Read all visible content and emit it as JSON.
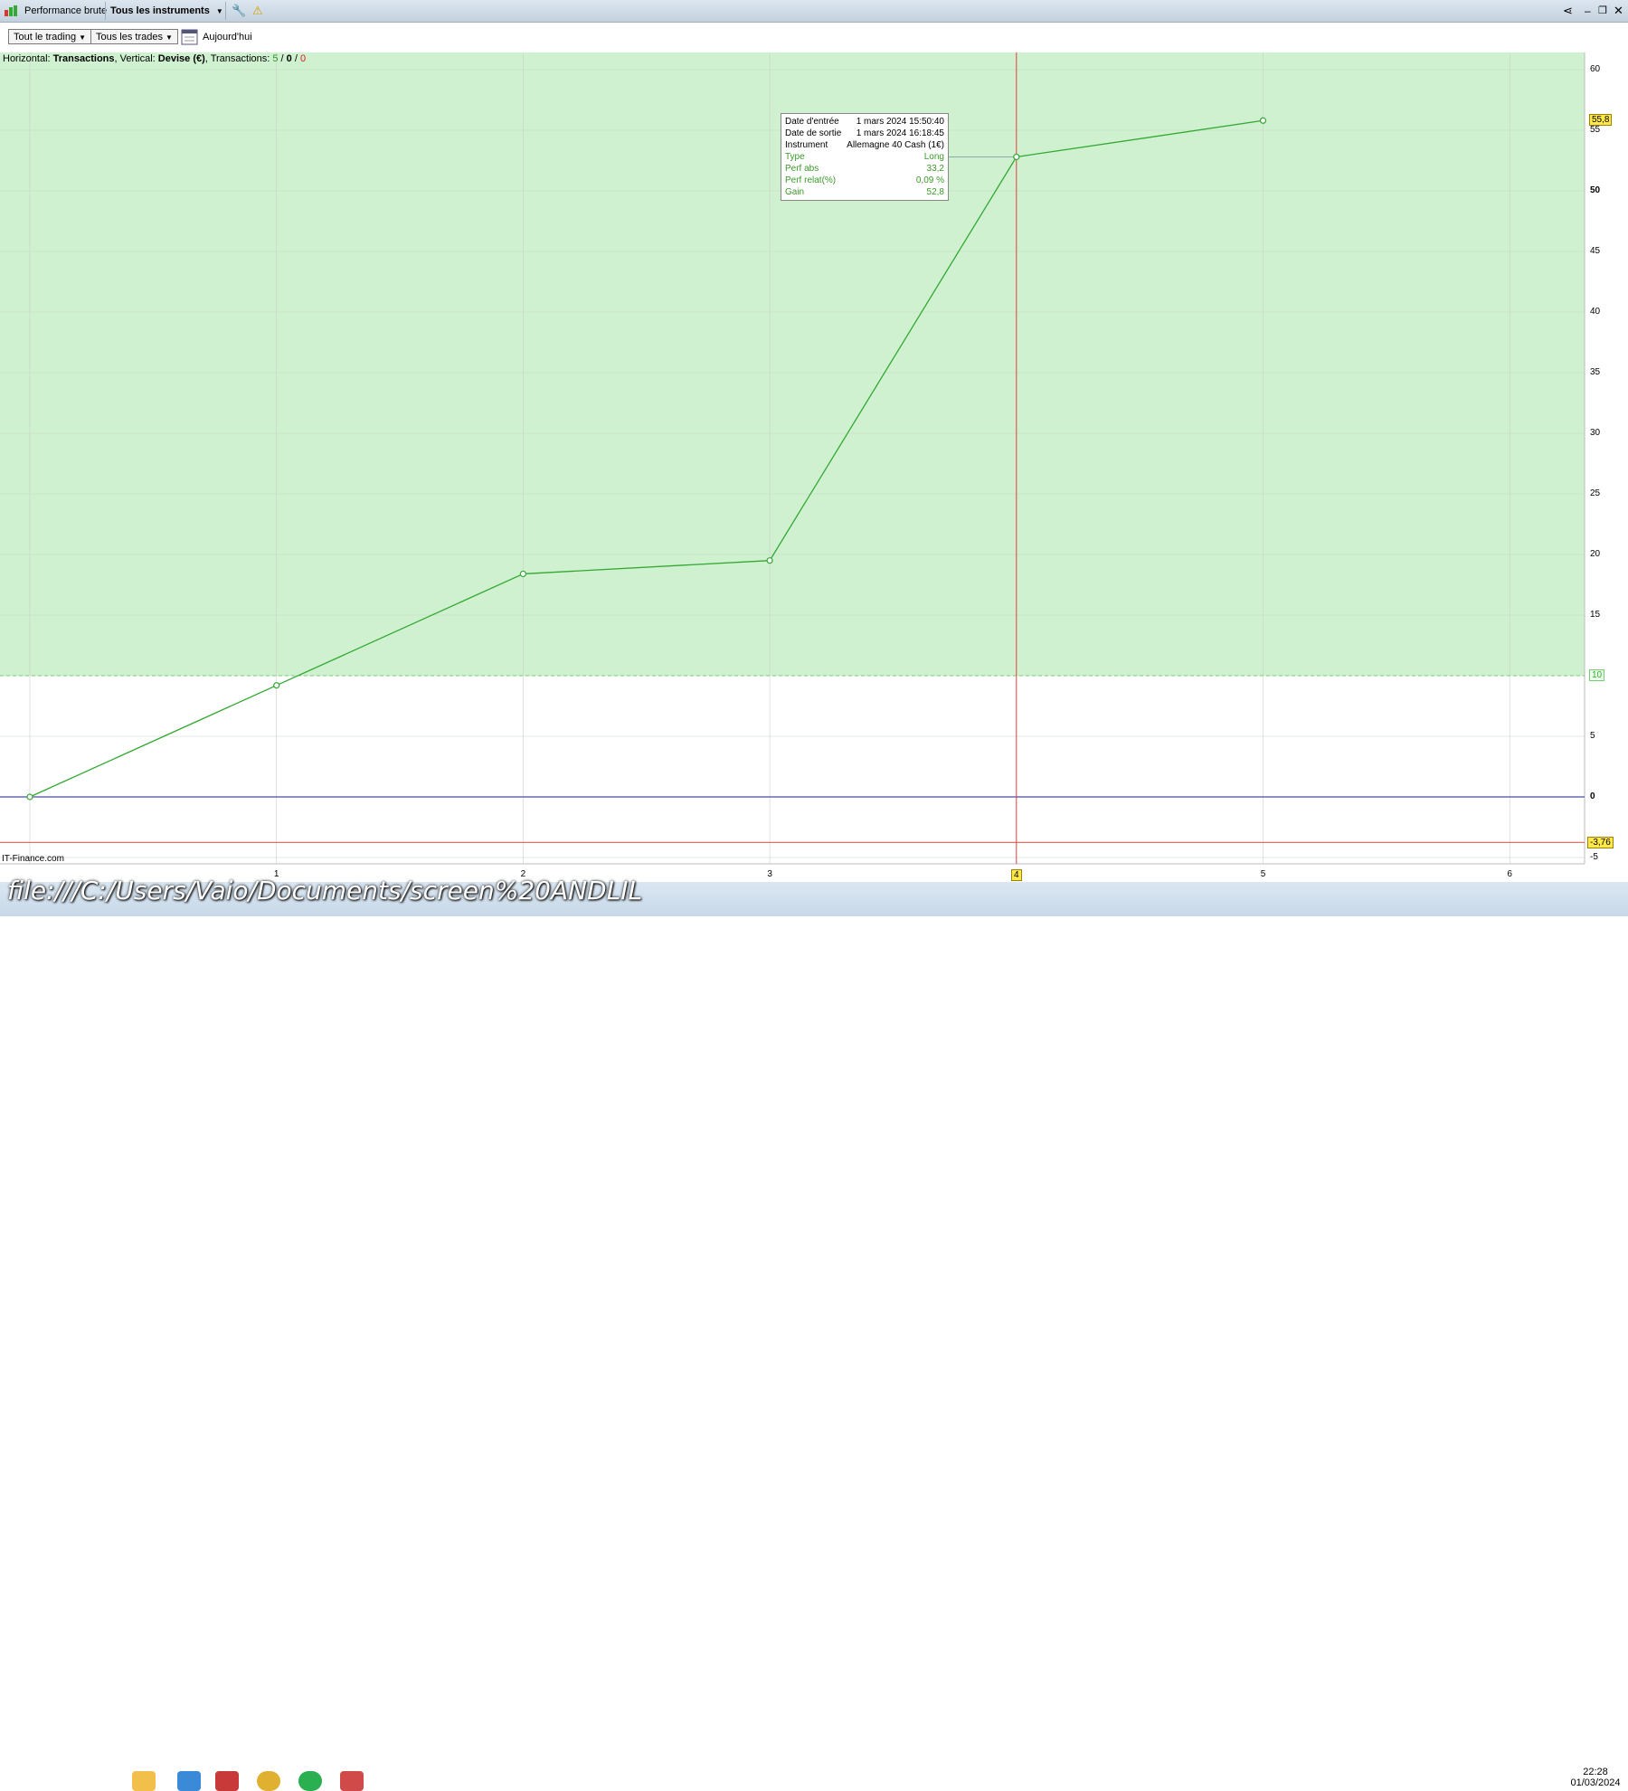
{
  "titlebar": {
    "perf_label": "Performance brute",
    "instruments_label": "Tous les instruments"
  },
  "toolbar": {
    "trading_label": "Tout le trading",
    "trades_label": "Tous les trades",
    "today_label": "Aujourd'hui"
  },
  "caption": {
    "h_prefix": "Horizontal: ",
    "h_value": "Transactions",
    "v_prefix": ", Vertical: ",
    "v_value": "Devise (€)",
    "t_prefix": ", Transactions: ",
    "t_win": "5",
    "t_sep1": " / ",
    "t_neutral": "0",
    "t_sep2": " / ",
    "t_loss": "0"
  },
  "tooltip": {
    "rows": [
      {
        "k": "Date d'entrée",
        "v": "1 mars 2024 15:50:40"
      },
      {
        "k": "Date de sortie",
        "v": "1 mars 2024 16:18:45"
      },
      {
        "k": "Instrument",
        "v": "Allemagne 40 Cash (1€)"
      },
      {
        "k": "Type",
        "v": "Long"
      },
      {
        "k": "Perf abs",
        "v": "33,2"
      },
      {
        "k": "Perf relat(%)",
        "v": "0,09 %"
      },
      {
        "k": "Gain",
        "v": "52,8"
      }
    ]
  },
  "badges": {
    "top": "55,8",
    "mid": "10",
    "low": "-3,76",
    "xsel": "4"
  },
  "watermark": "IT-Finance.com",
  "url_overlay": "file:///C:/Users/Vaio/Documents/screen%20ANDLIL",
  "clock": {
    "time": "22:28",
    "date": "01/03/2024"
  },
  "colors": {
    "profit_zone": "#cff1cf",
    "line": "#33a833",
    "zero_line": "#4a4aa8",
    "cursor": "#e04040",
    "low_line": "#e07070"
  },
  "chart_data": {
    "type": "line",
    "x": [
      0,
      1,
      2,
      3,
      4,
      5
    ],
    "values": [
      0,
      9.2,
      18.4,
      19.5,
      52.8,
      55.8
    ],
    "xticks": [
      "1",
      "2",
      "3",
      "4",
      "5",
      "6"
    ],
    "yticks": [
      "60",
      "55",
      "50",
      "45",
      "40",
      "35",
      "30",
      "25",
      "20",
      "15",
      "10",
      "5",
      "0",
      "-5"
    ],
    "ylim": [
      -5,
      60
    ],
    "profit_threshold": 10,
    "low_level": -3.76,
    "selected_x": 4
  }
}
